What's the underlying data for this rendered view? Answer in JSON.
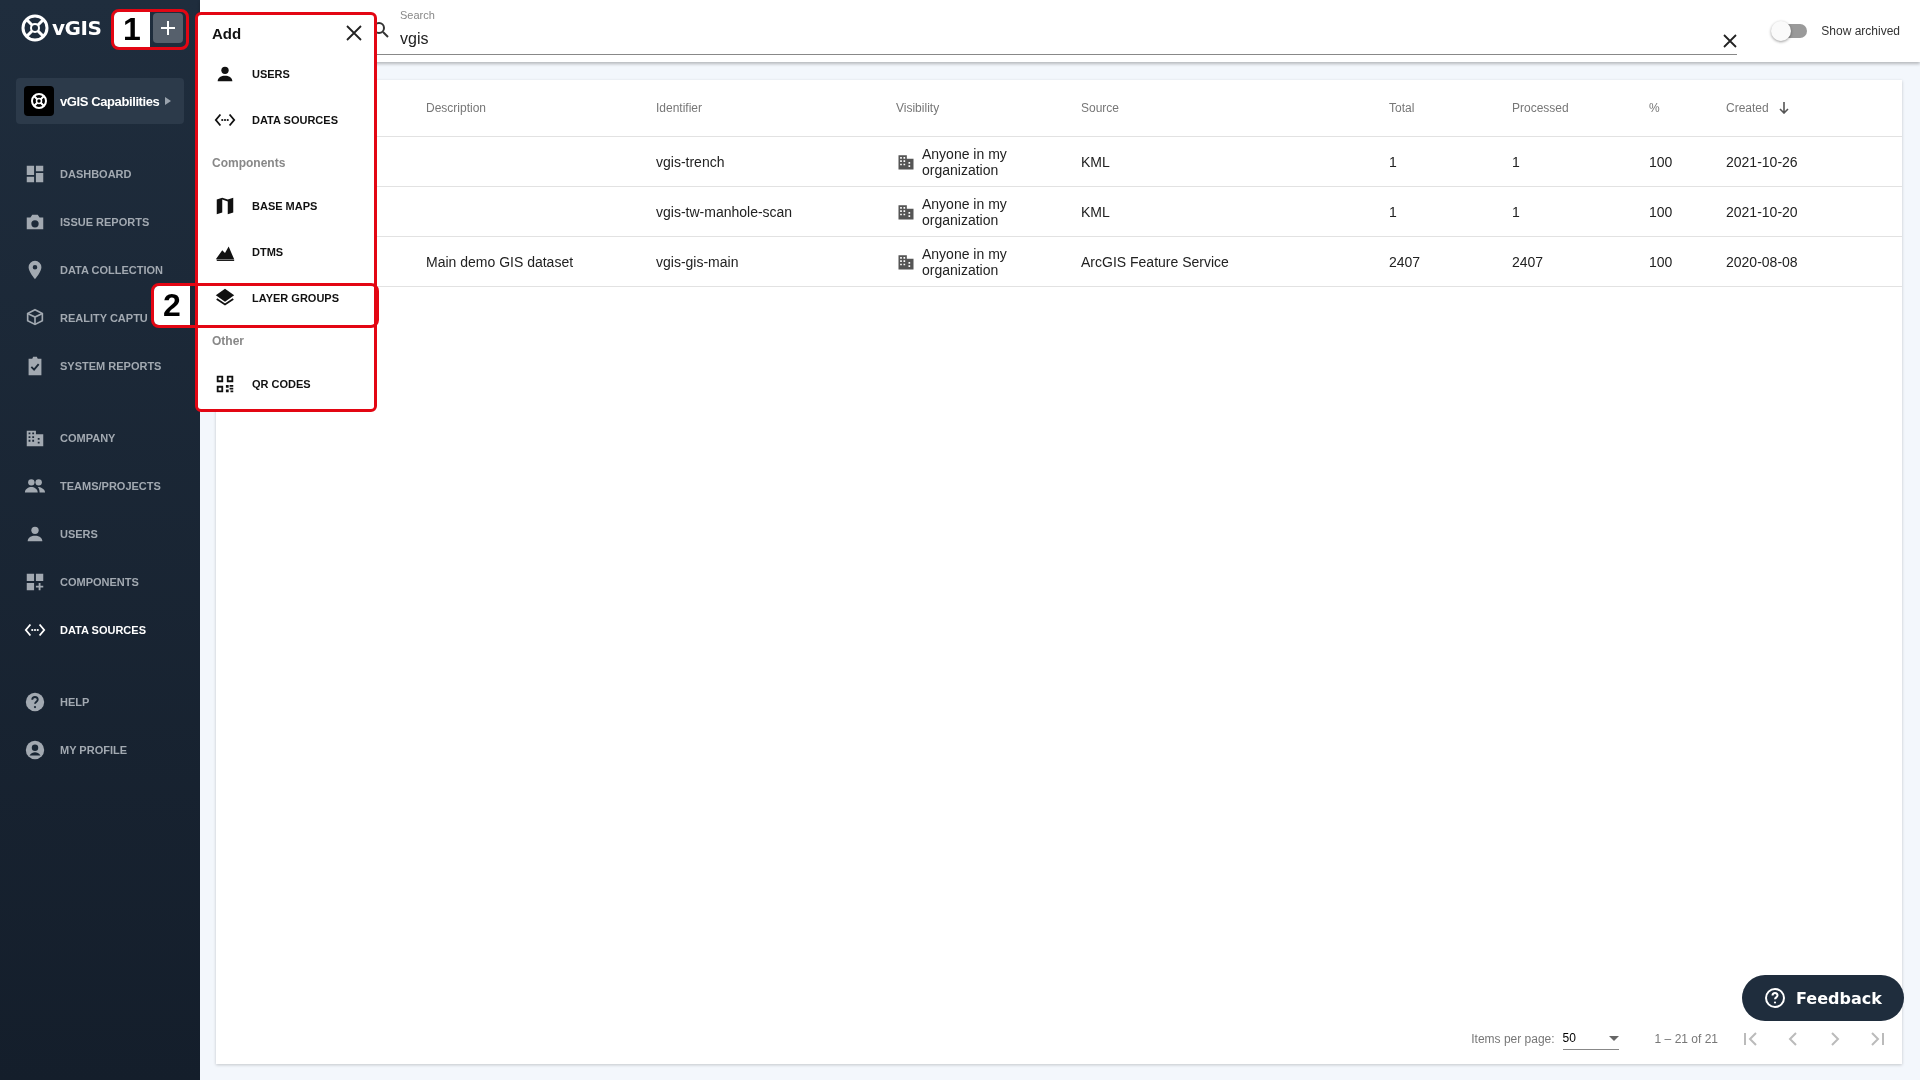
{
  "logo": {
    "text": "vGIS"
  },
  "workspace": {
    "name": "vGIS Capabilities"
  },
  "sidebar": {
    "groups": [
      {
        "items": [
          {
            "label": "DASHBOARD",
            "selected": false
          },
          {
            "label": "ISSUE REPORTS",
            "selected": false
          },
          {
            "label": "DATA COLLECTION",
            "selected": false
          },
          {
            "label": "REALITY CAPTU",
            "selected": false
          },
          {
            "label": "SYSTEM REPORTS",
            "selected": false
          }
        ]
      },
      {
        "items": [
          {
            "label": "COMPANY",
            "selected": false
          },
          {
            "label": "TEAMS/PROJECTS",
            "selected": false
          },
          {
            "label": "USERS",
            "selected": false
          },
          {
            "label": "COMPONENTS",
            "selected": false
          },
          {
            "label": "DATA SOURCES",
            "selected": true
          }
        ]
      },
      {
        "items": [
          {
            "label": "HELP",
            "selected": false
          },
          {
            "label": "MY PROFILE",
            "selected": false
          }
        ]
      }
    ]
  },
  "search": {
    "label": "Search",
    "value": "vgis"
  },
  "show_archived": {
    "label": "Show archived",
    "on": false
  },
  "add_menu": {
    "title": "Add",
    "sections": [
      {
        "items": [
          {
            "label": "USERS"
          },
          {
            "label": "DATA SOURCES"
          }
        ]
      },
      {
        "title": "Components",
        "items": [
          {
            "label": "BASE MAPS"
          },
          {
            "label": "DTMS"
          },
          {
            "label": "LAYER GROUPS"
          }
        ]
      },
      {
        "title": "Other",
        "items": [
          {
            "label": "QR CODES"
          }
        ]
      }
    ]
  },
  "table": {
    "columns": [
      {
        "label": "Description",
        "sorted": false
      },
      {
        "label": "Identifier",
        "sorted": false
      },
      {
        "label": "Visibility",
        "sorted": false
      },
      {
        "label": "Source",
        "sorted": false
      },
      {
        "label": "Total",
        "sorted": false
      },
      {
        "label": "Processed",
        "sorted": false
      },
      {
        "label": "%",
        "sorted": false
      },
      {
        "label": "Created",
        "sorted": true
      }
    ],
    "rows": [
      {
        "description": "",
        "identifier": "vgis-trench",
        "visibility": "Anyone in my organization",
        "source": "KML",
        "total": "1",
        "processed": "1",
        "percent": "100",
        "created": "2021-10-26"
      },
      {
        "description": "",
        "identifier": "vgis-tw-manhole-scan",
        "visibility": "Anyone in my organization",
        "source": "KML",
        "total": "1",
        "processed": "1",
        "percent": "100",
        "created": "2021-10-20"
      },
      {
        "description": "Main demo GIS dataset",
        "identifier": "vgis-gis-main",
        "visibility": "Anyone in my organization",
        "source": "ArcGIS Feature Service",
        "total": "2407",
        "processed": "2407",
        "percent": "100",
        "created": "2020-08-08"
      }
    ]
  },
  "pagination": {
    "label": "Items per page:",
    "value": "50",
    "range": "1 – 21 of 21"
  },
  "feedback": {
    "label": "Feedback"
  },
  "annotations": [
    {
      "label": "1"
    },
    {
      "label": "2"
    }
  ]
}
